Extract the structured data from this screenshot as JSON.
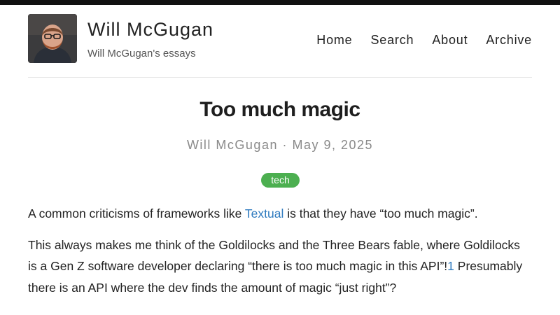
{
  "site": {
    "title": "Will McGugan",
    "subtitle": "Will McGugan's essays"
  },
  "nav": {
    "items": [
      {
        "label": "Home"
      },
      {
        "label": "Search"
      },
      {
        "label": "About"
      },
      {
        "label": "Archive"
      }
    ]
  },
  "post": {
    "title": "Too much magic",
    "author": "Will McGugan",
    "separator": "·",
    "date": "May 9, 2025",
    "tag": "tech"
  },
  "article": {
    "p1_before": "A common criticisms of frameworks like ",
    "p1_link": "Textual",
    "p1_after": " is that they have “too much magic”.",
    "p2_before": "This always makes me think of the Goldilocks and the Three Bears fable, where Goldilocks is a Gen Z software developer declaring “there is too much magic in this API”!",
    "p2_footnote": "1",
    "p2_after": " Presumably there is an API where the dev finds the amount of magic “just right”?"
  },
  "colors": {
    "accent_link": "#2f7bbf",
    "tag_bg": "#4caf50",
    "topbar": "#111111"
  }
}
